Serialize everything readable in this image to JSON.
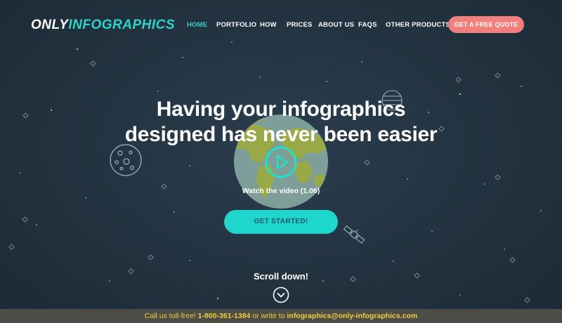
{
  "header": {
    "logo_part1": "ONLY",
    "logo_part2": "INFOGRAPHICS",
    "nav": [
      {
        "label": "HOME",
        "active": true
      },
      {
        "label": "PORTFOLIO"
      },
      {
        "label": "HOW"
      },
      {
        "label": "PRICES"
      },
      {
        "label": "ABOUT US"
      },
      {
        "label": "FAQS"
      },
      {
        "label": "OTHER PRODUCTS"
      }
    ],
    "cta_label": "GET A FREE QUOTE"
  },
  "hero": {
    "headline_line1": "Having your infographics",
    "headline_line2": "designed has never been easier",
    "video_label": "Watch the video (1.06)",
    "start_label": "GET STARTED!",
    "scroll_label": "Scroll down!",
    "play_icon": "play-icon",
    "scroll_icon": "chevron-down-icon"
  },
  "footer": {
    "prefix": "Call us toll-free!",
    "phone": "1-800-361-1384",
    "middle": "or write to",
    "email": "infographics@only-infographics.com"
  },
  "colors": {
    "accent_teal": "#2fd3c8",
    "button_teal": "#1ed6cc",
    "quote_coral": "#f27f7b",
    "background": "#22323f",
    "footer_bg": "#4c4d49",
    "footer_text": "#f2ce3b"
  }
}
